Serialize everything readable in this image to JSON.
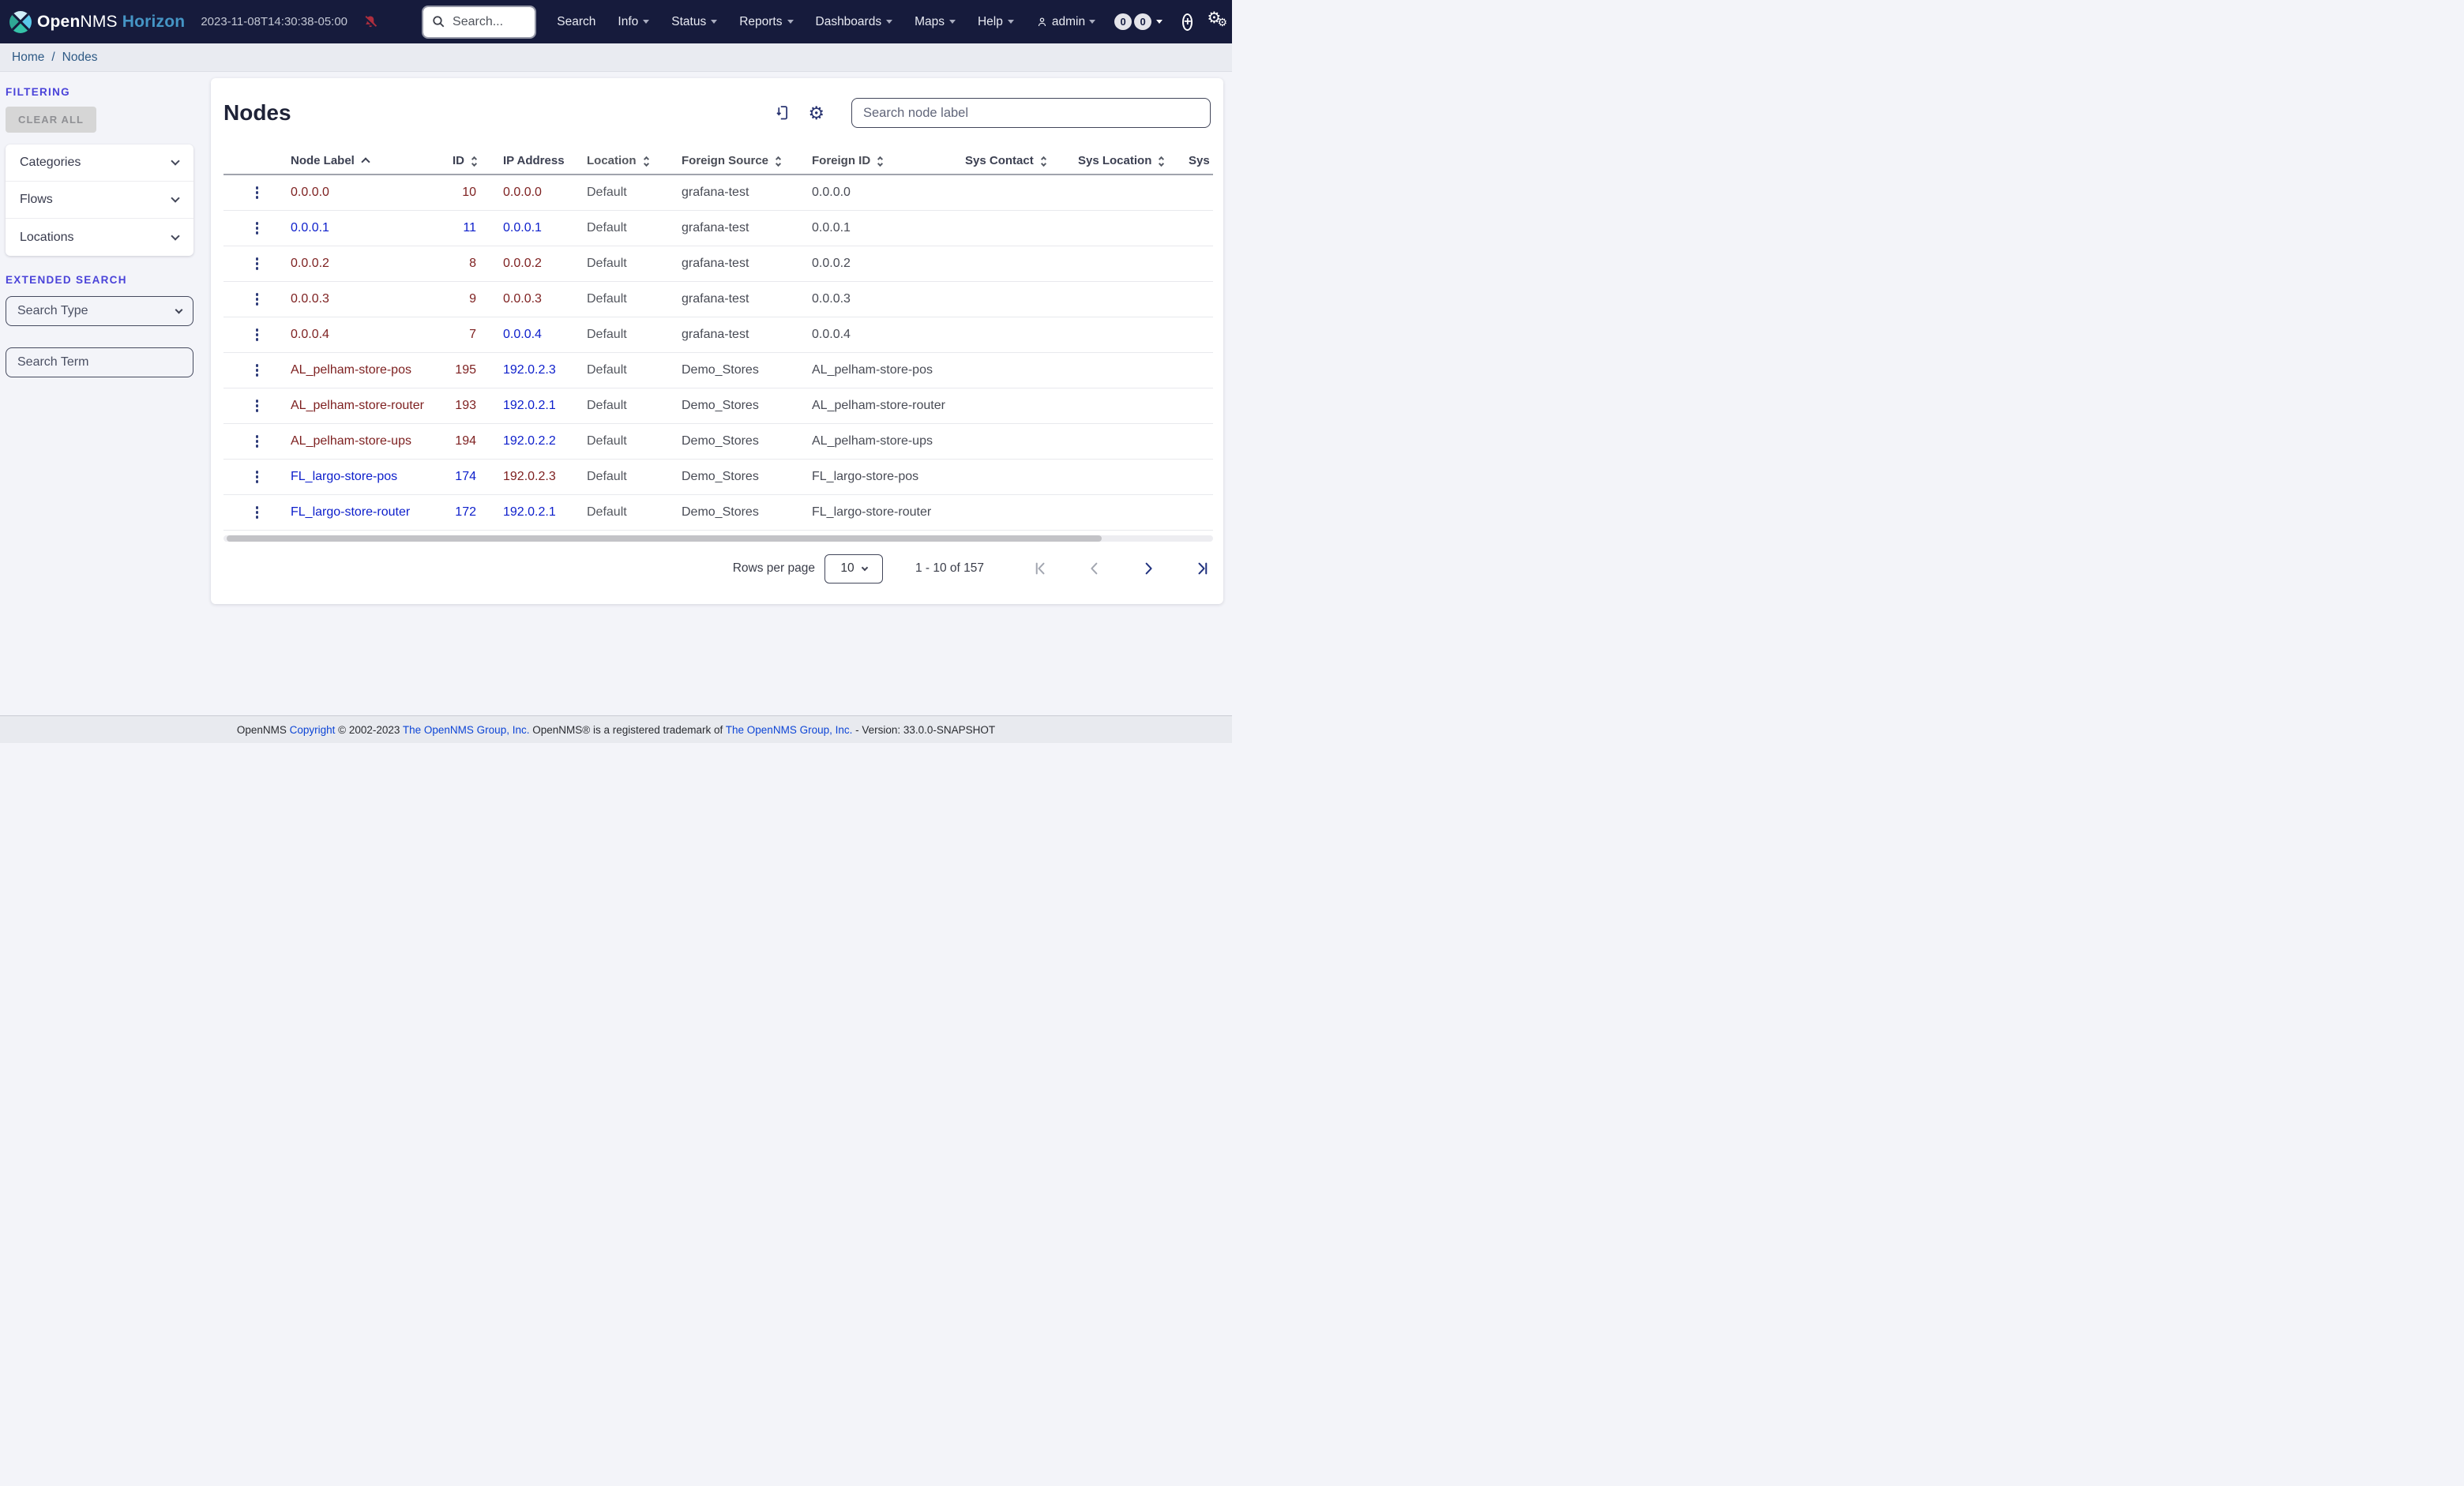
{
  "colors": {
    "navbar_bg": "#161b3c",
    "accent_indigo": "#4a43d9",
    "horizon_blue": "#4595c5",
    "bell_red": "#ae2e3e",
    "link_red": "#7d1f1f",
    "link_blue": "#0c1ecb",
    "toolbar_icon_navy": "#283371"
  },
  "navbar": {
    "brand_open": "Open",
    "brand_nms": "NMS",
    "brand_product": "Horizon",
    "timestamp": "2023-11-08T14:30:38-05:00",
    "search_placeholder": "Search...",
    "menu": [
      {
        "label": "Search",
        "caret": false
      },
      {
        "label": "Info",
        "caret": true
      },
      {
        "label": "Status",
        "caret": true
      },
      {
        "label": "Reports",
        "caret": true
      },
      {
        "label": "Dashboards",
        "caret": true
      },
      {
        "label": "Maps",
        "caret": true
      },
      {
        "label": "Help",
        "caret": true
      }
    ],
    "user_label": "admin",
    "badges": [
      "0",
      "0"
    ]
  },
  "breadcrumb": {
    "home": "Home",
    "separator": "/",
    "current": "Nodes"
  },
  "sidebar": {
    "filtering_label": "FILTERING",
    "clear_all_label": "CLEAR ALL",
    "accordions": [
      "Categories",
      "Flows",
      "Locations"
    ],
    "extended_search_label": "EXTENDED SEARCH",
    "search_type_placeholder": "Search Type",
    "search_term_placeholder": "Search Term"
  },
  "main": {
    "title": "Nodes",
    "node_search_placeholder": "Search node label"
  },
  "table": {
    "columns": [
      {
        "label": "Node Label",
        "sort": "asc"
      },
      {
        "label": "ID",
        "sort": "both",
        "align": "right"
      },
      {
        "label": "IP Address",
        "sort": "none"
      },
      {
        "label": "Location",
        "sort": "both"
      },
      {
        "label": "Foreign Source",
        "sort": "both"
      },
      {
        "label": "Foreign ID",
        "sort": "both"
      },
      {
        "label": "Sys Contact",
        "sort": "both"
      },
      {
        "label": "Sys Location",
        "sort": "both"
      },
      {
        "label": "Sys D",
        "sort": "none"
      }
    ],
    "rows": [
      {
        "label": "0.0.0.0",
        "label_color": "red",
        "id": "10",
        "id_color": "red",
        "ip": "0.0.0.0",
        "ip_color": "red",
        "location": "Default",
        "foreign_source": "grafana-test",
        "foreign_id": "0.0.0.0",
        "sys_contact": "",
        "sys_location": "",
        "sys_description": ""
      },
      {
        "label": "0.0.0.1",
        "label_color": "blue",
        "id": "11",
        "id_color": "blue",
        "ip": "0.0.0.1",
        "ip_color": "blue",
        "location": "Default",
        "foreign_source": "grafana-test",
        "foreign_id": "0.0.0.1",
        "sys_contact": "",
        "sys_location": "",
        "sys_description": ""
      },
      {
        "label": "0.0.0.2",
        "label_color": "red",
        "id": "8",
        "id_color": "red",
        "ip": "0.0.0.2",
        "ip_color": "red",
        "location": "Default",
        "foreign_source": "grafana-test",
        "foreign_id": "0.0.0.2",
        "sys_contact": "",
        "sys_location": "",
        "sys_description": ""
      },
      {
        "label": "0.0.0.3",
        "label_color": "red",
        "id": "9",
        "id_color": "red",
        "ip": "0.0.0.3",
        "ip_color": "red",
        "location": "Default",
        "foreign_source": "grafana-test",
        "foreign_id": "0.0.0.3",
        "sys_contact": "",
        "sys_location": "",
        "sys_description": ""
      },
      {
        "label": "0.0.0.4",
        "label_color": "red",
        "id": "7",
        "id_color": "red",
        "ip": "0.0.0.4",
        "ip_color": "blue",
        "location": "Default",
        "foreign_source": "grafana-test",
        "foreign_id": "0.0.0.4",
        "sys_contact": "",
        "sys_location": "",
        "sys_description": ""
      },
      {
        "label": "AL_pelham-store-pos",
        "label_color": "red",
        "id": "195",
        "id_color": "red",
        "ip": "192.0.2.3",
        "ip_color": "blue",
        "location": "Default",
        "foreign_source": "Demo_Stores",
        "foreign_id": "AL_pelham-store-pos",
        "sys_contact": "",
        "sys_location": "",
        "sys_description": ""
      },
      {
        "label": "AL_pelham-store-router",
        "label_color": "red",
        "id": "193",
        "id_color": "red",
        "ip": "192.0.2.1",
        "ip_color": "blue",
        "location": "Default",
        "foreign_source": "Demo_Stores",
        "foreign_id": "AL_pelham-store-router",
        "sys_contact": "",
        "sys_location": "",
        "sys_description": ""
      },
      {
        "label": "AL_pelham-store-ups",
        "label_color": "red",
        "id": "194",
        "id_color": "red",
        "ip": "192.0.2.2",
        "ip_color": "blue",
        "location": "Default",
        "foreign_source": "Demo_Stores",
        "foreign_id": "AL_pelham-store-ups",
        "sys_contact": "",
        "sys_location": "",
        "sys_description": ""
      },
      {
        "label": "FL_largo-store-pos",
        "label_color": "blue",
        "id": "174",
        "id_color": "blue",
        "ip": "192.0.2.3",
        "ip_color": "red",
        "location": "Default",
        "foreign_source": "Demo_Stores",
        "foreign_id": "FL_largo-store-pos",
        "sys_contact": "",
        "sys_location": "",
        "sys_description": ""
      },
      {
        "label": "FL_largo-store-router",
        "label_color": "blue",
        "id": "172",
        "id_color": "blue",
        "ip": "192.0.2.1",
        "ip_color": "blue",
        "location": "Default",
        "foreign_source": "Demo_Stores",
        "foreign_id": "FL_largo-store-router",
        "sys_contact": "",
        "sys_location": "",
        "sys_description": ""
      }
    ]
  },
  "pagination": {
    "rows_per_page_label": "Rows per page",
    "page_size": "10",
    "range_text": "1 - 10 of 157",
    "buttons": [
      {
        "name": "first-page",
        "enabled": false
      },
      {
        "name": "prev-page",
        "enabled": false
      },
      {
        "name": "next-page",
        "enabled": true
      },
      {
        "name": "last-page",
        "enabled": true
      }
    ]
  },
  "footer": {
    "segments": [
      {
        "text": "OpenNMS ",
        "link": false
      },
      {
        "text": "Copyright",
        "link": true
      },
      {
        "text": " © 2002-2023 ",
        "link": false
      },
      {
        "text": "The OpenNMS Group, Inc.",
        "link": true
      },
      {
        "text": " OpenNMS® is a registered trademark of ",
        "link": false
      },
      {
        "text": "The OpenNMS Group, Inc.",
        "link": true
      },
      {
        "text": " - Version: 33.0.0-SNAPSHOT",
        "link": false
      }
    ]
  }
}
